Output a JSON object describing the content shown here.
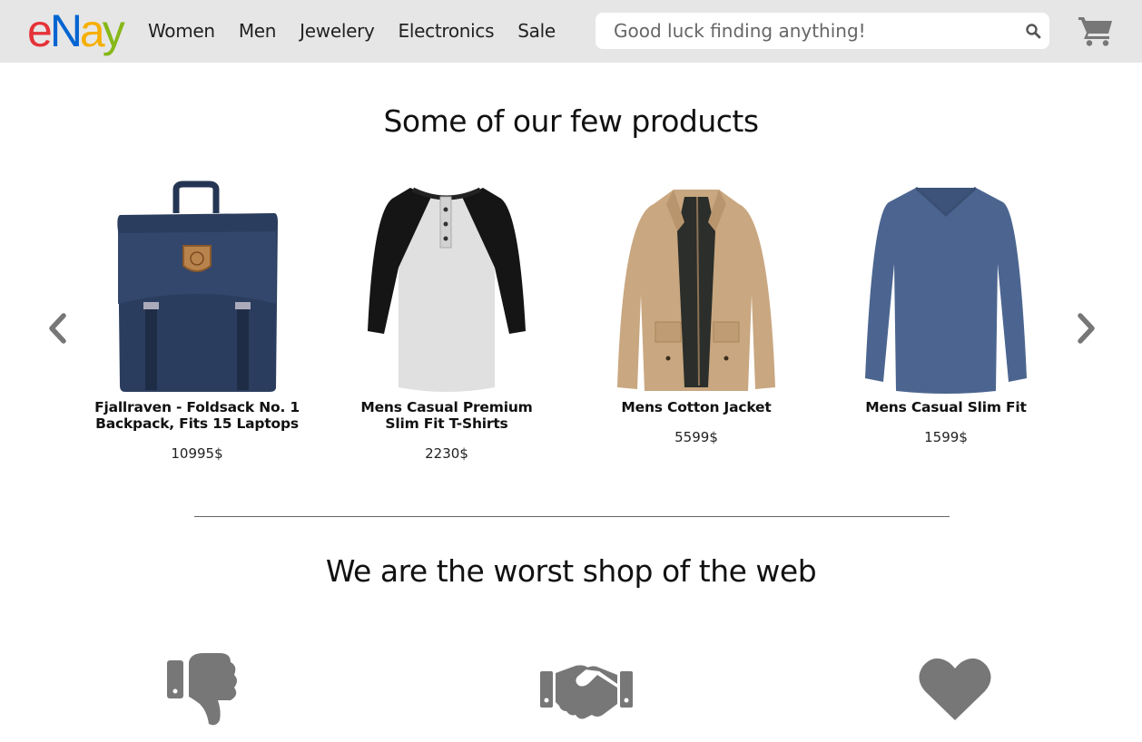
{
  "header": {
    "logo_letters": [
      {
        "char": "e",
        "color": "#e53238"
      },
      {
        "char": "N",
        "color": "#0064d2"
      },
      {
        "char": "a",
        "color": "#f5af02"
      },
      {
        "char": "y",
        "color": "#86b817"
      }
    ],
    "nav": [
      "Women",
      "Men",
      "Jewelery",
      "Electronics",
      "Sale"
    ],
    "search_placeholder": "Good luck finding anything!",
    "search_icon": "search-icon",
    "cart_icon": "shopping-cart-icon"
  },
  "products_section": {
    "title": "Some of our few products",
    "prev_icon": "chevron-left-icon",
    "next_icon": "chevron-right-icon",
    "products": [
      {
        "name": "Fjallraven - Foldsack No. 1 Backpack, Fits 15 Laptops",
        "price": "10995$",
        "image": "backpack"
      },
      {
        "name": "Mens Casual Premium Slim Fit T-Shirts",
        "price": "2230$",
        "image": "raglan-tshirt"
      },
      {
        "name": "Mens Cotton Jacket",
        "price": "5599$",
        "image": "jacket"
      },
      {
        "name": "Mens Casual Slim Fit",
        "price": "1599$",
        "image": "long-sleeve-shirt"
      }
    ]
  },
  "features_section": {
    "title": "We are the worst shop of the web",
    "icons": [
      "thumbs-down-icon",
      "handshake-icon",
      "heart-icon"
    ]
  },
  "colors": {
    "header_bg": "#e6e6e6",
    "icon_gray": "#777777"
  }
}
